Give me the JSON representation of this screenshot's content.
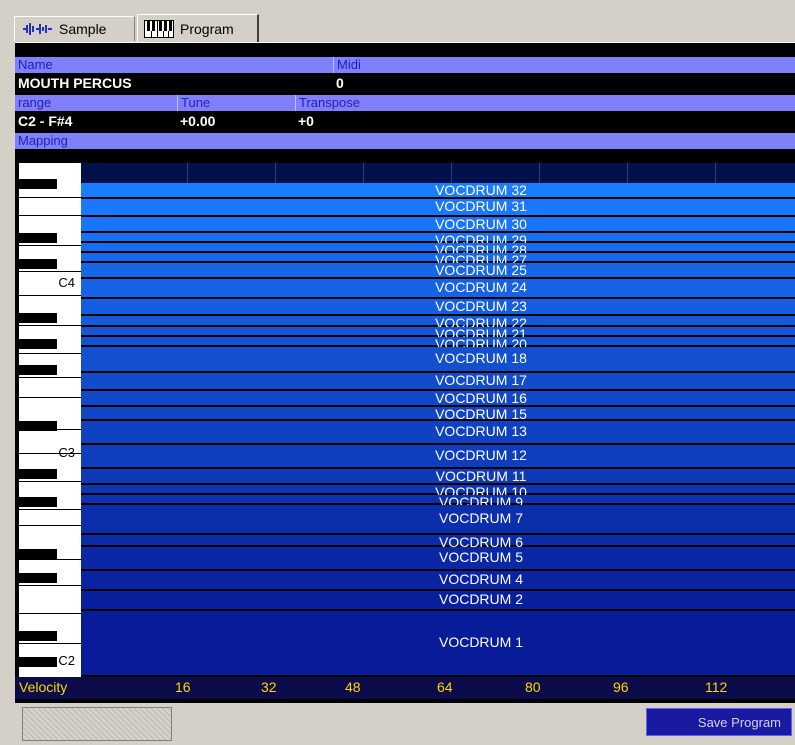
{
  "tabs": [
    {
      "label": "Sample",
      "icon": "waveform-icon"
    },
    {
      "label": "Program",
      "icon": "piano-icon"
    }
  ],
  "header1": {
    "name_label": "Name",
    "midi_label": "Midi"
  },
  "values1": {
    "name": "MOUTH PERCUS",
    "midi": "0"
  },
  "header2": {
    "range_label": "range",
    "tune_label": "Tune",
    "transpose_label": "Transpose"
  },
  "values2": {
    "range": "C2 - F#4",
    "tune": "+0.00",
    "transpose": "+0"
  },
  "mapping_label": "Mapping",
  "key_labels": {
    "c4": "C4",
    "c3": "C3",
    "c2": "C2"
  },
  "zones": [
    "VOCDRUM 32",
    "VOCDRUM 31",
    "VOCDRUM 30",
    "VOCDRUM 29",
    "VOCDRUM 28",
    "VOCDRUM 27",
    "VOCDRUM 25",
    "VOCDRUM 24",
    "VOCDRUM 23",
    "VOCDRUM 22",
    "VOCDRUM 21",
    "VOCDRUM 20",
    "VOCDRUM 18",
    "VOCDRUM 17",
    "VOCDRUM 16",
    "VOCDRUM 15",
    "VOCDRUM 13",
    "VOCDRUM 12",
    "VOCDRUM 11",
    "VOCDRUM 10",
    "VOCDRUM 9",
    "VOCDRUM 7",
    "VOCDRUM 6",
    "VOCDRUM 5",
    "VOCDRUM 4",
    "VOCDRUM 2",
    "VOCDRUM 1"
  ],
  "velocity": {
    "label": "Velocity",
    "ticks": [
      "16",
      "32",
      "48",
      "64",
      "80",
      "96",
      "112"
    ]
  },
  "save_button": "Save Program",
  "colors": {
    "header": "#8080f8",
    "zone_light": "#1a7cff",
    "zone_dark": "#0a1fa0",
    "velocity_text": "#ffd800"
  }
}
